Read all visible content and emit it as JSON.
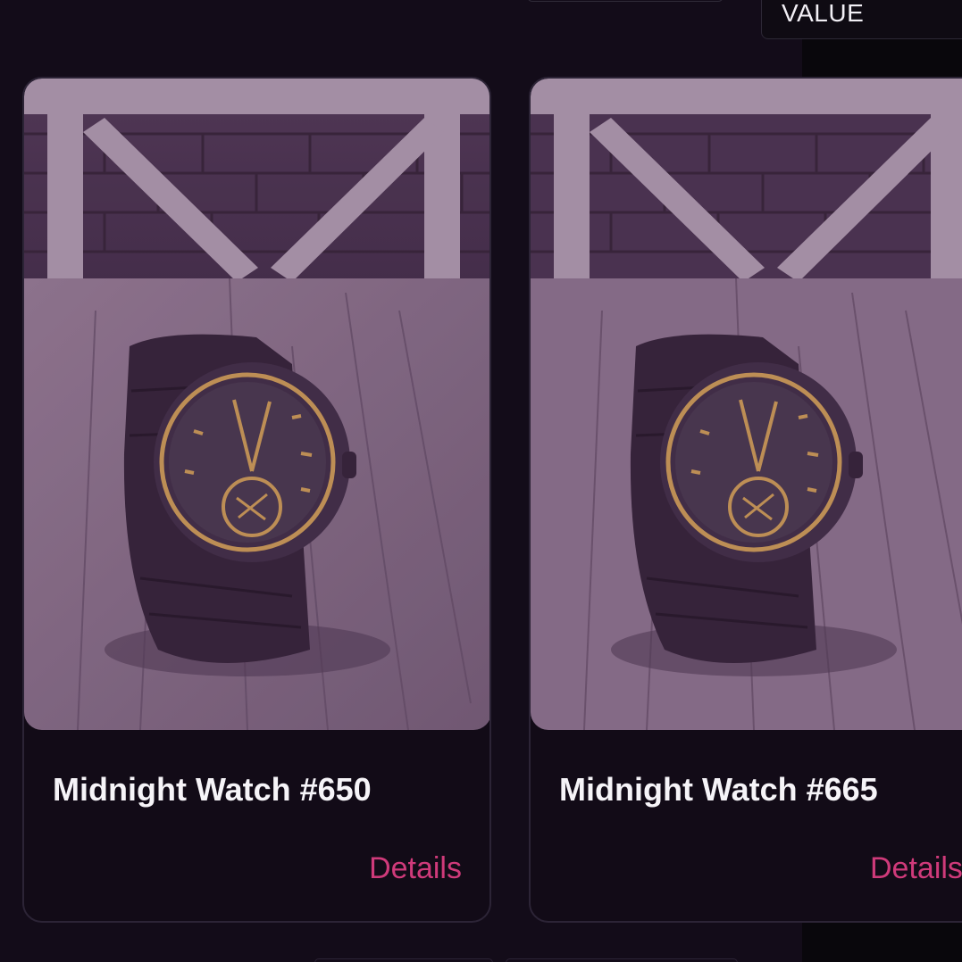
{
  "filters": {
    "sort_value": "VALUE"
  },
  "cards": [
    {
      "title": "Midnight Watch #650",
      "action": "Details"
    },
    {
      "title": "Midnight Watch #665",
      "action": "Details"
    }
  ],
  "colors": {
    "background": "#130c19",
    "accent": "#cf3a7a",
    "card_border": "#2c2436"
  }
}
